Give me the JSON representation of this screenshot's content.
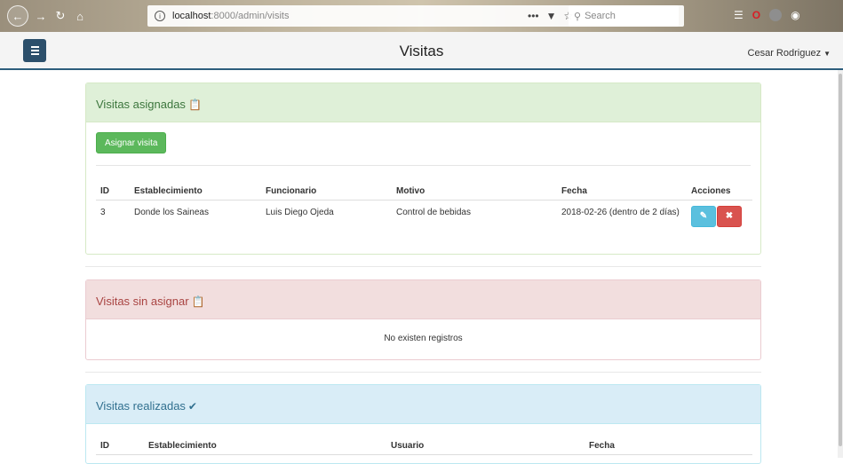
{
  "browser": {
    "url_prefix": "ⓘ",
    "url_host": "localhost",
    "url_path": ":8000/admin/visits",
    "page_actions": "•••",
    "search_placeholder": "Search"
  },
  "header": {
    "title": "Visitas",
    "user": "Cesar Rodriguez"
  },
  "assigned": {
    "title": "Visitas asignadas",
    "assign_button": "Asignar visita",
    "columns": [
      "ID",
      "Establecimiento",
      "Funcionario",
      "Motivo",
      "Fecha",
      "Acciones"
    ],
    "rows": [
      {
        "id": "3",
        "establecimiento": "Donde los Saineas",
        "funcionario": "Luis Diego Ojeda",
        "motivo": "Control de bebidas",
        "fecha": "2018-02-26 (dentro de 2 días)"
      }
    ]
  },
  "unassigned": {
    "title": "Visitas sin asignar",
    "empty_message": "No existen registros"
  },
  "done": {
    "title": "Visitas realizadas",
    "columns": [
      "ID",
      "Establecimiento",
      "Usuario",
      "Fecha"
    ]
  },
  "colors": {
    "success": "#5cb85c",
    "danger": "#d9534f",
    "info": "#5bc0de",
    "header_border": "#2c5d7c"
  }
}
